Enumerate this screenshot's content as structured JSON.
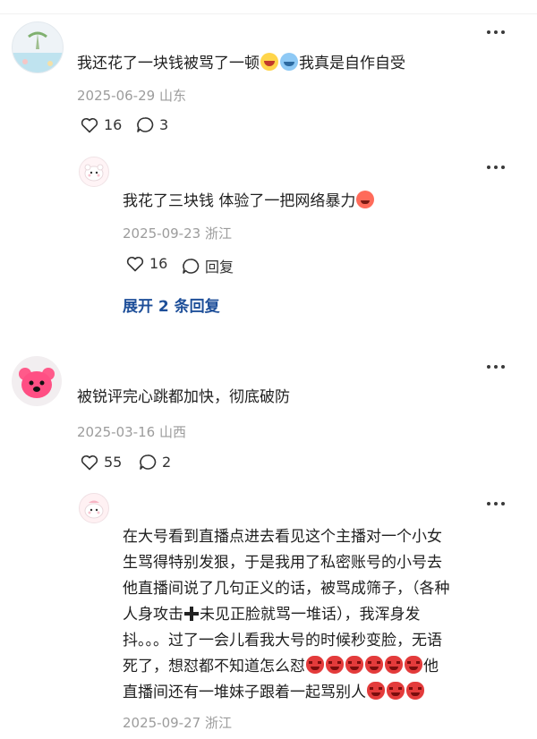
{
  "comments": [
    {
      "text": "我还花了一块钱被骂了一顿",
      "emoji_1": "crying-face-icon",
      "emoji_2": "sobbing-face-icon",
      "text_tail": "我真是自作自受",
      "date": "2025-06-29",
      "location": "山东",
      "likes": "16",
      "replies": "3",
      "reply": {
        "text": "我花了三块钱 体验了一把网络暴力",
        "emoji": "scared-face-icon",
        "date": "2025-09-23",
        "location": "浙江",
        "likes": "16",
        "reply_label": "回复"
      },
      "expand_label": "展开 2 条回复"
    },
    {
      "text": "被锐评完心跳都加快，彻底破防",
      "date": "2025-03-16",
      "location": "山西",
      "likes": "55",
      "replies": "2",
      "reply": {
        "line1": "在大号看到直播点进去看见这个主播对一个小女",
        "line2": "生骂得特别发狠，于是我用了私密账号的小号去",
        "line3": "他直播间说了几句正义的话，被骂成筛子，（各种",
        "line4a": "人身攻击",
        "line4b": "未见正脸就骂一堆话），我浑身发",
        "line5": "抖。。。过了一会儿看我大号的时候秒变脸，无语",
        "line6a": "死了，想怼都不知道怎么怼",
        "line6b": "他",
        "line7": "直播间还有一堆妹子跟着一起骂别人",
        "date": "2025-09-27",
        "location": "浙江"
      }
    }
  ]
}
